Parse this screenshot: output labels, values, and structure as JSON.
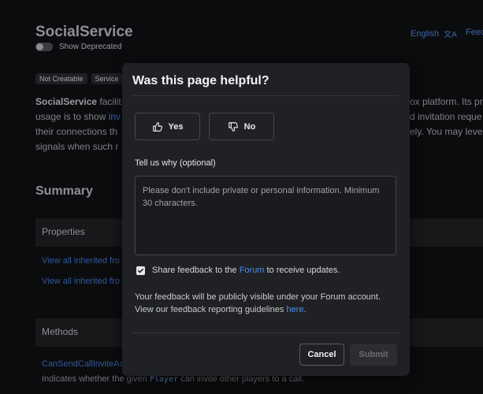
{
  "background": {
    "title": "SocialService",
    "toggle_label": "Show Deprecated",
    "language": "English",
    "feedback_cut": "Feec",
    "tags": [
      "Not Creatable",
      "Service"
    ],
    "desc_line1_bold": "SocialService",
    "desc_line1_rest": " facilit",
    "desc_line2_a": "usage is to show ",
    "desc_line2_link": "inv",
    "desc_line3": "their connections th",
    "desc_line4": "signals when such r",
    "desc_right1": "ox platform. Its pr",
    "desc_right2": "d invitation reque",
    "desc_right3": "ely. You may leve",
    "summary": "Summary",
    "properties_header": "Properties",
    "inherited1": "View all inherited fro",
    "inherited2": "View all inherited fro",
    "methods_header": "Methods",
    "method_link": "CanSendCallInviteAs",
    "method_desc_a": "Indicates whether the given ",
    "method_desc_code": "Player",
    "method_desc_b": " can invite other players to a call."
  },
  "modal": {
    "title": "Was this page helpful?",
    "yes_label": "Yes",
    "no_label": "No",
    "why_label": "Tell us why (optional)",
    "why_placeholder": "Please don't include private or personal information. Minimum 30 characters.",
    "share_prefix": "Share feedback to the ",
    "share_link": "Forum",
    "share_suffix": " to receive updates.",
    "share_checked": true,
    "note_text": "Your feedback will be publicly visible under your Forum account. View our feedback reporting guidelines ",
    "note_link": "here",
    "note_end": ".",
    "cancel_label": "Cancel",
    "submit_label": "Submit"
  },
  "colors": {
    "link": "#4f8ef0",
    "modal_bg": "#1f2124",
    "page_bg": "#0b0c0e"
  }
}
